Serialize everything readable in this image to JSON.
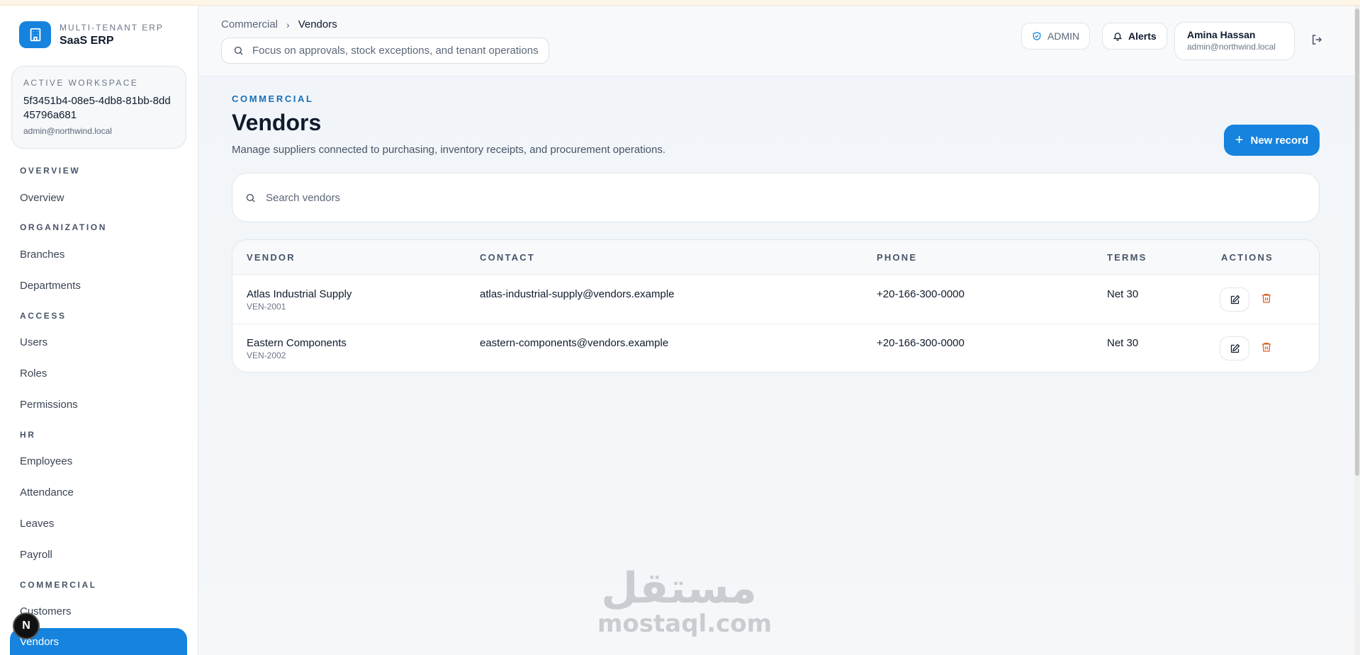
{
  "brand": {
    "eyebrow": "MULTI-TENANT ERP",
    "name": "SaaS ERP",
    "color": "#1683de"
  },
  "workspace": {
    "label": "ACTIVE WORKSPACE",
    "id": "5f3451b4-08e5-4db8-81bb-8dd45796a681",
    "email": "admin@northwind.local"
  },
  "nav": {
    "overview": {
      "title": "OVERVIEW",
      "items": [
        "Overview"
      ]
    },
    "organization": {
      "title": "ORGANIZATION",
      "items": [
        "Branches",
        "Departments"
      ]
    },
    "access": {
      "title": "ACCESS",
      "items": [
        "Users",
        "Roles",
        "Permissions"
      ]
    },
    "hr": {
      "title": "HR",
      "items": [
        "Employees",
        "Attendance",
        "Leaves",
        "Payroll"
      ]
    },
    "commercial": {
      "title": "COMMERCIAL",
      "items": [
        "Customers",
        "Vendors"
      ]
    },
    "active_item": "Vendors"
  },
  "badge": {
    "letter": "N"
  },
  "header": {
    "breadcrumb": {
      "parent": "Commercial",
      "separator": "›",
      "current": "Vendors"
    },
    "search_placeholder": "Focus on approvals, stock exceptions, and tenant operations",
    "role_label": "ADMIN",
    "alerts_label": "Alerts",
    "user": {
      "name": "Amina Hassan",
      "email": "admin@northwind.local"
    }
  },
  "page": {
    "eyebrow": "COMMERCIAL",
    "title": "Vendors",
    "description": "Manage suppliers connected to purchasing, inventory receipts, and procurement operations.",
    "new_button": "New record",
    "search_placeholder": "Search vendors"
  },
  "table": {
    "columns": [
      "VENDOR",
      "CONTACT",
      "PHONE",
      "TERMS",
      "ACTIONS"
    ],
    "rows": [
      {
        "vendor": "Atlas Industrial Supply",
        "code": "VEN-2001",
        "contact": "atlas-industrial-supply@vendors.example",
        "phone": "+20-166-300-0000",
        "terms": "Net 30"
      },
      {
        "vendor": "Eastern Components",
        "code": "VEN-2002",
        "contact": "eastern-components@vendors.example",
        "phone": "+20-166-300-0000",
        "terms": "Net 30"
      }
    ]
  },
  "watermark": {
    "arabic": "مستقل",
    "latin": "mostaql.com"
  }
}
